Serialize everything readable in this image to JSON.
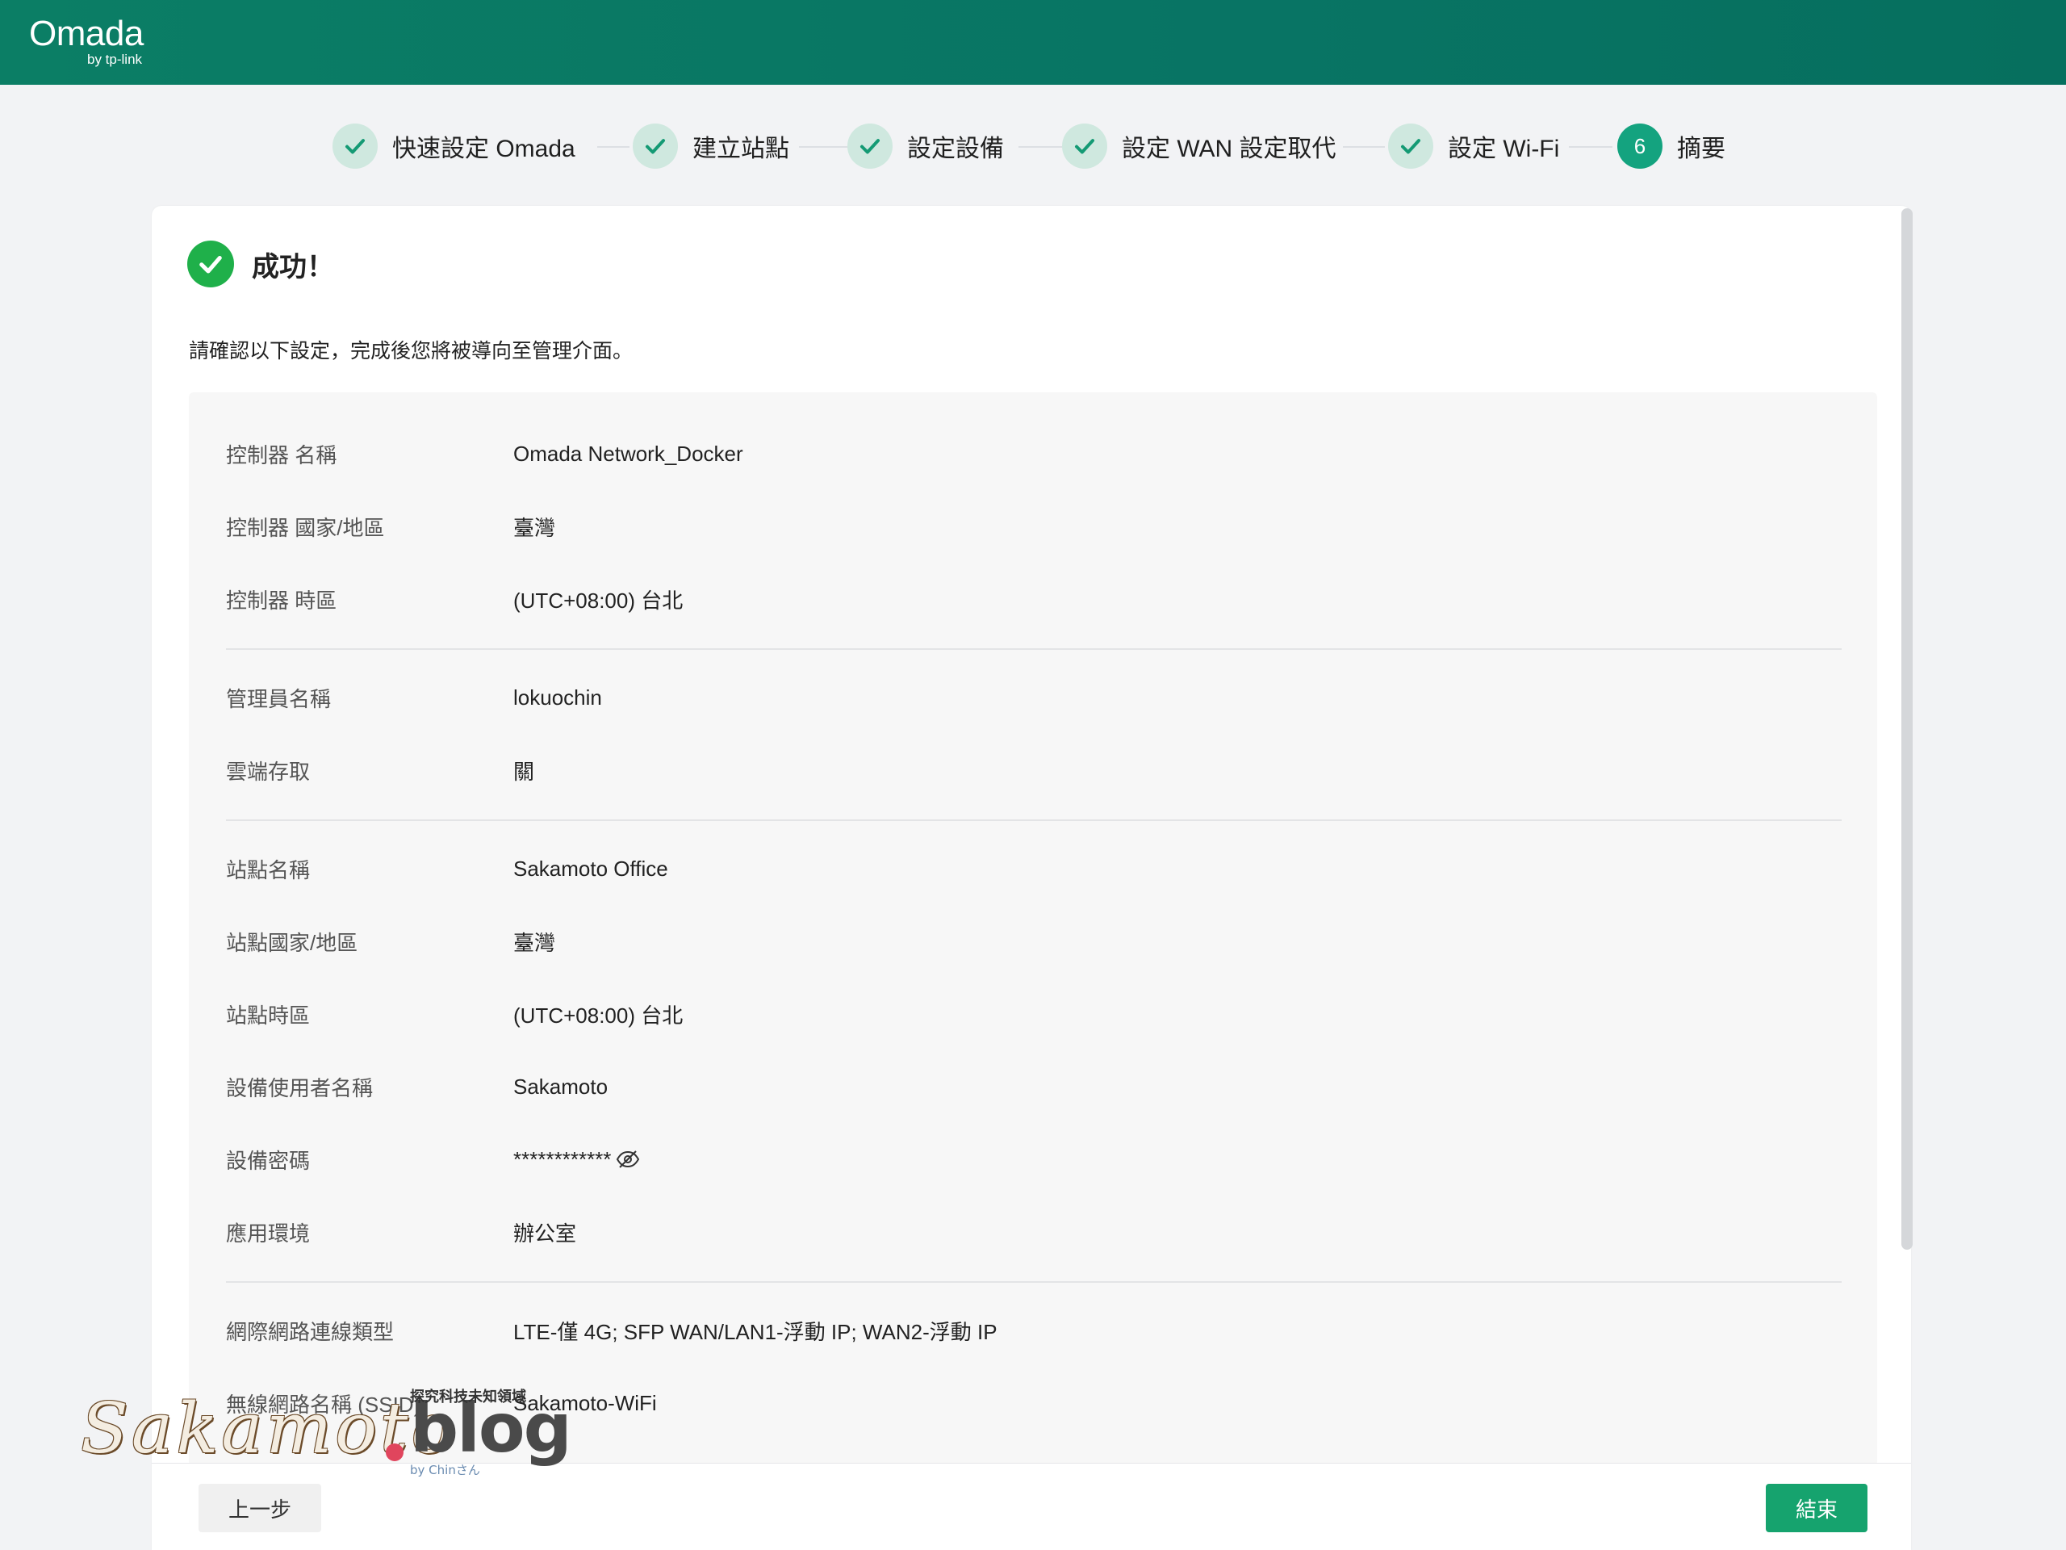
{
  "app": {
    "logo_text": "Omada",
    "logo_sub": "by tp-link"
  },
  "colors": {
    "header": "#0b7e65",
    "accent": "#14a37f",
    "success": "#1fb04a",
    "finish_button": "#16a36e"
  },
  "stepper": {
    "steps": [
      {
        "label": "快速設定 Omada",
        "status": "done",
        "icon": "check-icon"
      },
      {
        "label": "建立站點",
        "status": "done",
        "icon": "check-icon"
      },
      {
        "label": "設定設備",
        "status": "done",
        "icon": "check-icon"
      },
      {
        "label": "設定 WAN 設定取代",
        "status": "done",
        "icon": "check-icon"
      },
      {
        "label": "設定 Wi-Fi",
        "status": "done",
        "icon": "check-icon"
      },
      {
        "label": "摘要",
        "status": "active",
        "number": "6"
      }
    ]
  },
  "result": {
    "title": "成功！",
    "description": "請確認以下設定，完成後您將被導向至管理介面。"
  },
  "summary": {
    "group1": [
      {
        "label": "控制器 名稱",
        "value": "Omada Network_Docker"
      },
      {
        "label": "控制器 國家/地區",
        "value": "臺灣"
      },
      {
        "label": "控制器 時區",
        "value": "(UTC+08:00) 台北"
      }
    ],
    "group2": [
      {
        "label": "管理員名稱",
        "value": "lokuochin"
      },
      {
        "label": "雲端存取",
        "value": "關"
      }
    ],
    "group3": [
      {
        "label": "站點名稱",
        "value": "Sakamoto Office"
      },
      {
        "label": "站點國家/地區",
        "value": "臺灣"
      },
      {
        "label": "站點時區",
        "value": "(UTC+08:00) 台北"
      },
      {
        "label": "設備使用者名稱",
        "value": "Sakamoto"
      },
      {
        "label": "設備密碼",
        "value": "************"
      },
      {
        "label": "應用環境",
        "value": "辦公室"
      }
    ],
    "group4": [
      {
        "label": "網際網路連線類型",
        "value": "LTE-僅 4G; SFP WAN/LAN1-浮動 IP; WAN2-浮動 IP"
      },
      {
        "label": "無線網路名稱 (SSID)",
        "value": "Sakamoto-WiFi"
      }
    ]
  },
  "footer": {
    "prev_label": "上一步",
    "finish_label": "結束"
  },
  "watermark": {
    "script": "Sakamoto",
    "blog": "blog",
    "tagline": "探究科技未知領域",
    "by": "by Chinさん"
  }
}
